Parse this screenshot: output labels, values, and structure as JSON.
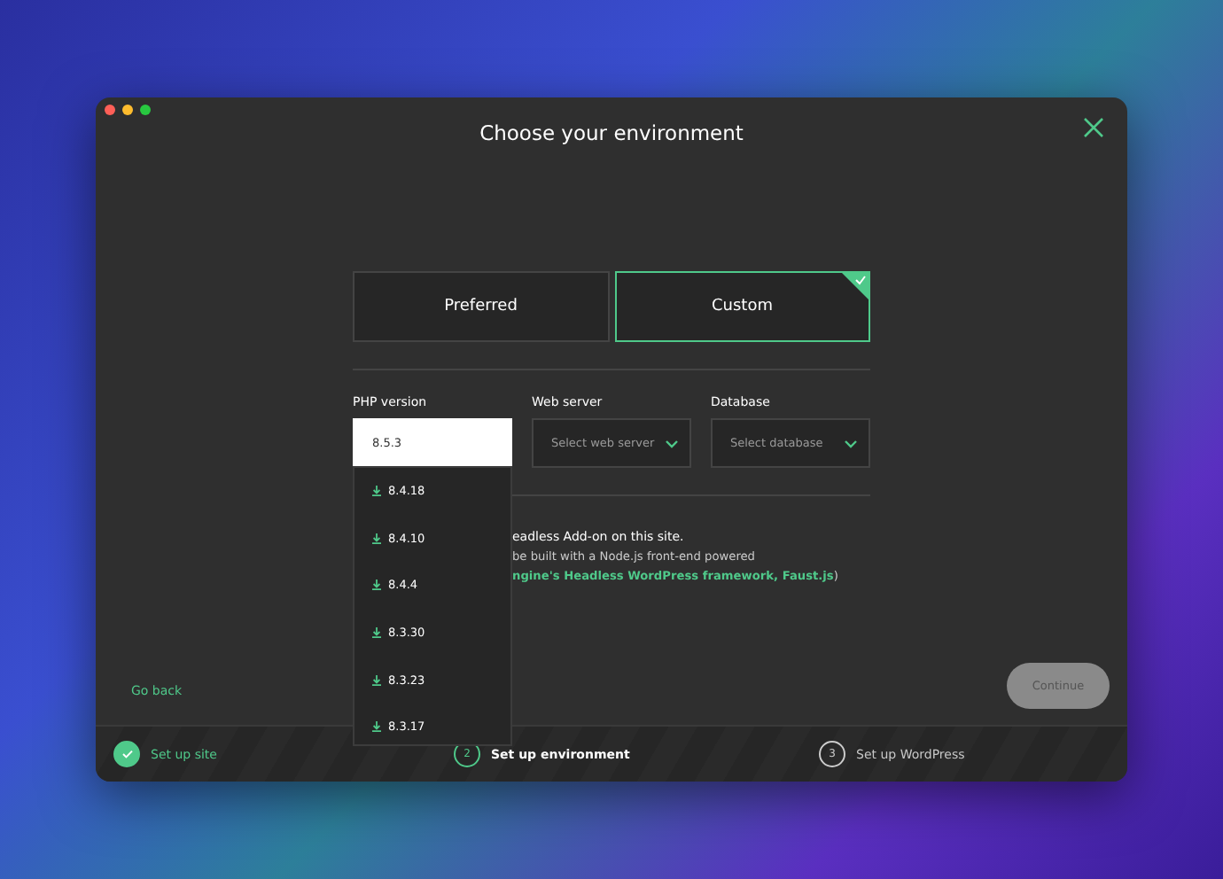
{
  "window": {
    "title": "Choose your environment"
  },
  "options": [
    {
      "label": "Preferred",
      "selected": false
    },
    {
      "label": "Custom",
      "selected": true
    }
  ],
  "fields": [
    {
      "label": "PHP version",
      "value": "8.5.3",
      "open": true
    },
    {
      "label": "Web server",
      "placeholder": "Select web server",
      "open": false
    },
    {
      "label": "Database",
      "placeholder": "Select database",
      "open": false
    }
  ],
  "php_menu": [
    "8.4.18",
    "8.4.10",
    "8.4.4",
    "8.3.30",
    "8.3.23",
    "8.3.17"
  ],
  "headless": {
    "title": "eadless Add-on on this site.",
    "line_1": "be built with a Node.js front-end powered",
    "link": "ngine's Headless WordPress framework, Faust.js",
    "line_end": ")"
  },
  "go_back": "Go back",
  "continue": {
    "label": "Continue",
    "disabled": true
  },
  "steps": [
    {
      "label": "Set up site",
      "done": true,
      "selected": false
    },
    {
      "number": "2",
      "label": "Set up environment",
      "done": false,
      "selected": true
    },
    {
      "number": "3",
      "label": "Set up WordPress",
      "done": false,
      "selected": false
    }
  ]
}
